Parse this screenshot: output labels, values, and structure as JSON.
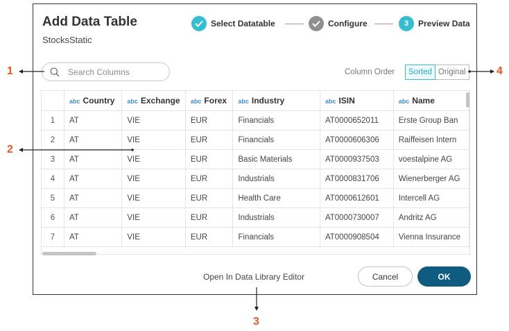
{
  "dialog": {
    "title": "Add Data Table",
    "subtitle": "StocksStatic"
  },
  "steps": [
    {
      "label": "Select Datatable",
      "state": "done",
      "color": "#36bdd0"
    },
    {
      "label": "Configure",
      "state": "done",
      "color": "#8f8f8f"
    },
    {
      "label": "Preview Data",
      "state": "current",
      "number": "3",
      "color": "#36bdd0"
    }
  ],
  "search": {
    "placeholder": "Search Columns"
  },
  "column_order": {
    "label": "Column Order",
    "options": [
      "Sorted",
      "Original"
    ],
    "selected": "Sorted"
  },
  "table": {
    "type_badge": "abc",
    "columns": [
      "Country",
      "Exchange",
      "Forex",
      "Industry",
      "ISIN",
      "Name"
    ],
    "rows": [
      [
        "1",
        "AT",
        "VIE",
        "EUR",
        "Financials",
        "AT0000652011",
        "Erste Group Ban"
      ],
      [
        "2",
        "AT",
        "VIE",
        "EUR",
        "Financials",
        "AT0000606306",
        "Raiffeisen Intern"
      ],
      [
        "3",
        "AT",
        "VIE",
        "EUR",
        "Basic Materials",
        "AT0000937503",
        "voestalpine AG"
      ],
      [
        "4",
        "AT",
        "VIE",
        "EUR",
        "Industrials",
        "AT0000831706",
        "Wienerberger AG"
      ],
      [
        "5",
        "AT",
        "VIE",
        "EUR",
        "Health Care",
        "AT0000612601",
        "Intercell AG"
      ],
      [
        "6",
        "AT",
        "VIE",
        "EUR",
        "Industrials",
        "AT0000730007",
        "Andritz AG"
      ],
      [
        "7",
        "AT",
        "VIE",
        "EUR",
        "Financials",
        "AT0000908504",
        "Vienna Insurance"
      ]
    ]
  },
  "footer": {
    "open_editor": "Open In Data Library Editor",
    "cancel": "Cancel",
    "ok": "OK"
  },
  "callouts": [
    "1",
    "2",
    "3",
    "4"
  ],
  "colors": {
    "accent": "#36bdd0",
    "primary_button": "#0f5c80",
    "callout": "#e05a26"
  }
}
